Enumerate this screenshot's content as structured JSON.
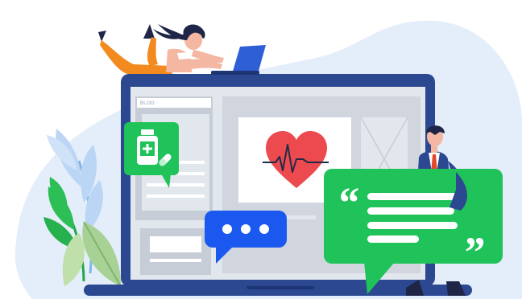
{
  "blog_tab": {
    "label": "BLOG"
  },
  "quote_marks": {
    "open": "“",
    "close": "”"
  },
  "icons": [
    "medicine-bottle-icon",
    "pill-capsule-icon",
    "heart-pulse-icon",
    "typing-dots-icon",
    "quote-icon"
  ],
  "colors": {
    "background_blob": "#e3eefa",
    "laptop_frame": "#2c4891",
    "laptop_screen": "#e2e7ee",
    "screen_panel": "#c7cdd6",
    "bubble_green": "#1fc35a",
    "bubble_blue": "#1a58f0",
    "heart": "#ec4a4f",
    "pulse_line": "#1f2b46",
    "leaf_blue": "#bad6f4",
    "leaf_green": "#2dbf55",
    "leaf_pale_green": "#a8d196",
    "woman_pants": "#f28a1f",
    "hair": "#1e2547",
    "skin": "#f4b7a2",
    "man_suit": "#2c4891",
    "tie": "#e4472b"
  }
}
